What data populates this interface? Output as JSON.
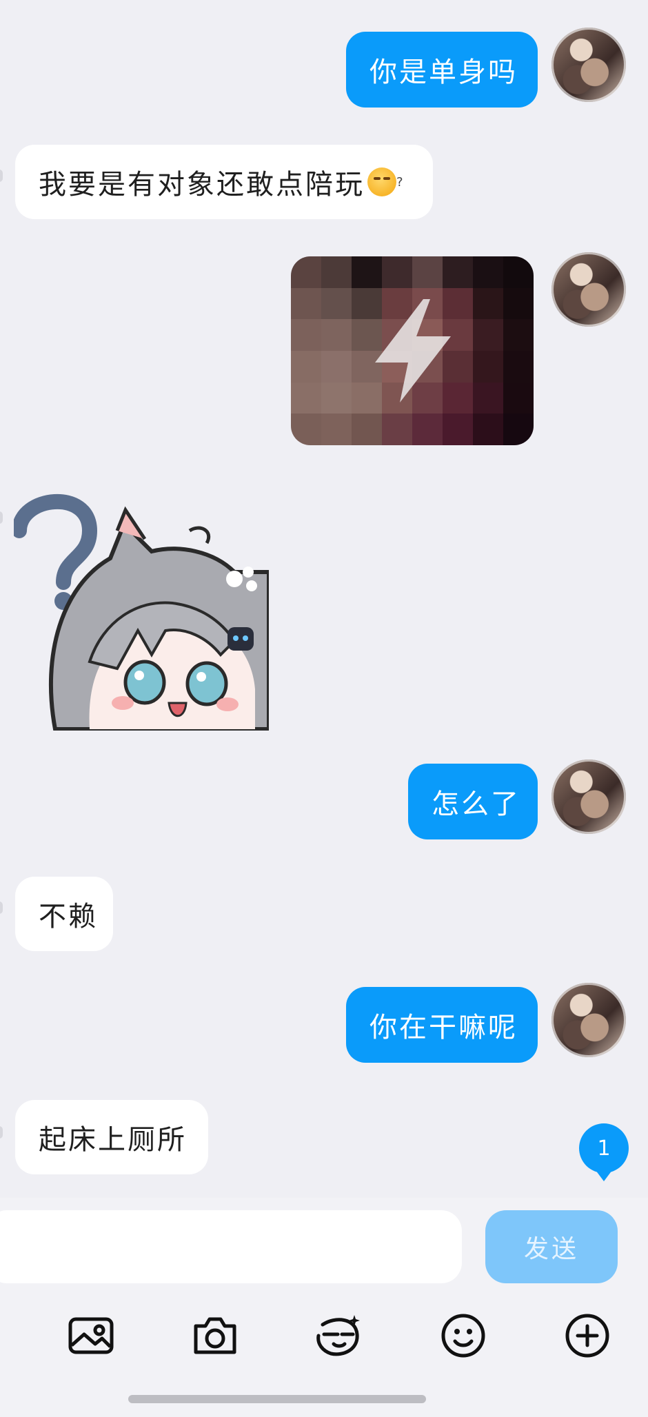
{
  "messages": [
    {
      "side": "out",
      "text": "你是单身吗"
    },
    {
      "side": "in",
      "text": "我要是有对象还敢点陪玩",
      "emoji": "thinking-face-emoji"
    },
    {
      "side": "out",
      "type": "image"
    },
    {
      "side": "in",
      "type": "sticker"
    },
    {
      "side": "out",
      "text": "怎么了"
    },
    {
      "side": "in",
      "text": "不赖"
    },
    {
      "side": "out",
      "text": "你在干嘛呢"
    },
    {
      "side": "in",
      "text": "起床上厕所"
    }
  ],
  "emoji_mark": "?",
  "unread_badge": "1",
  "composer": {
    "input_value": "",
    "send_label": "发送"
  },
  "toolbar": [
    "image-icon",
    "camera-icon",
    "face-sticker-icon",
    "emoji-icon",
    "plus-icon"
  ],
  "colors": {
    "outgoing_bubble": "#0A9BFA",
    "incoming_bubble": "#FFFFFF",
    "background": "#EFEFF4",
    "send_button_disabled": "#7EC6FA"
  }
}
